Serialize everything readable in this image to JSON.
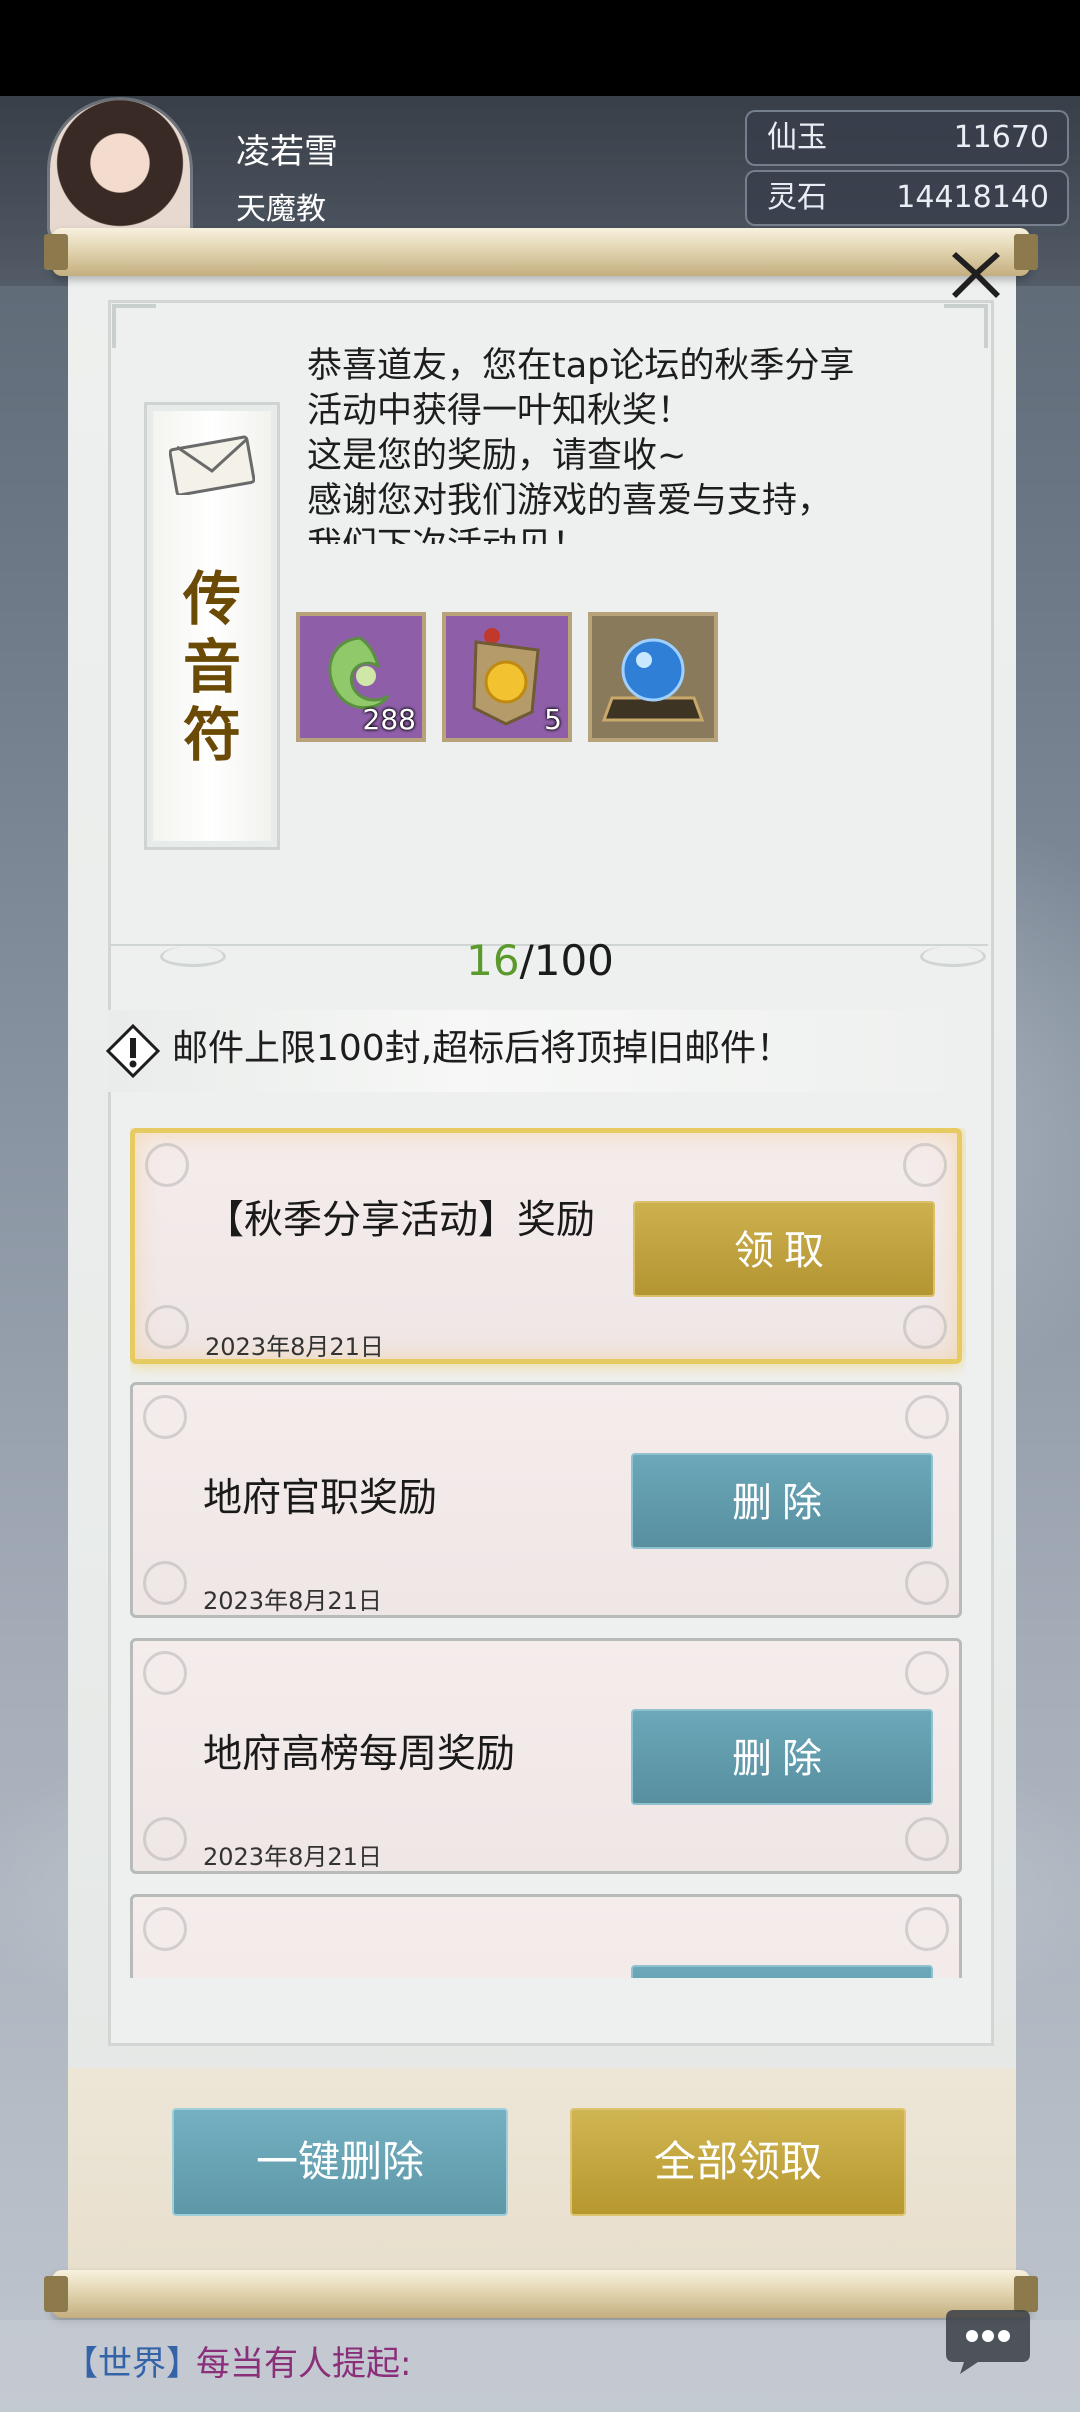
{
  "player": {
    "name": "凌若雪",
    "sect": "天魔教"
  },
  "currencies": [
    {
      "name": "仙玉",
      "value": "11670"
    },
    {
      "name": "灵石",
      "value": "14418140"
    }
  ],
  "mail_detail": {
    "seal_label": [
      "传",
      "音",
      "符"
    ],
    "message_lines": [
      "恭喜道友，您在tap论坛的秋季分享",
      "活动中获得一叶知秋奖！",
      "这是您的奖励，请查收~",
      "感谢您对我们游戏的喜爱与支持，",
      "我们下次活动见！"
    ],
    "rewards": [
      {
        "icon": "jade-ornament-icon",
        "count": "288",
        "bg": "#8e5fa8"
      },
      {
        "icon": "golden-token-icon",
        "count": "5",
        "bg": "#8e5fa8"
      },
      {
        "icon": "blue-orb-icon",
        "count": "",
        "bg": "#8a7a5c"
      }
    ]
  },
  "mail_count": {
    "current": "16",
    "separator": "/",
    "max": "100"
  },
  "warning": {
    "text": "邮件上限100封,超标后将顶掉旧邮件！"
  },
  "mails": [
    {
      "title": "【秋季分享活动】奖励",
      "date": "2023年8月21日",
      "action": "领取",
      "style": "gold",
      "selected": true
    },
    {
      "title": "地府官职奖励",
      "date": "2023年8月21日",
      "action": "删除",
      "style": "teal",
      "selected": false
    },
    {
      "title": "地府高榜每周奖励",
      "date": "2023年8月21日",
      "action": "删除",
      "style": "teal",
      "selected": false
    }
  ],
  "buttons": {
    "delete_all": "一键删除",
    "claim_all": "全部领取"
  },
  "chat": {
    "channel": "【世界】",
    "text": "每当有人提起:"
  },
  "colors": {
    "gold_button": "#c1a441",
    "teal_button": "#65a0b1",
    "count_current": "#5a9a2c",
    "seal_text": "#6b4a06"
  }
}
